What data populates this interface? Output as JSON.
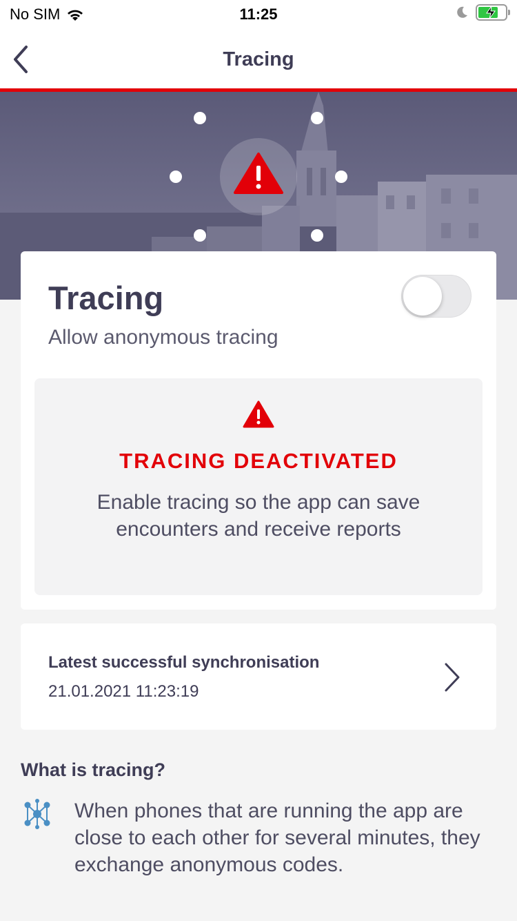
{
  "status_bar": {
    "carrier": "No SIM",
    "time": "11:25"
  },
  "nav": {
    "title": "Tracing",
    "accent_color": "#e20008"
  },
  "tracing_card": {
    "title": "Tracing",
    "subtitle": "Allow anonymous tracing",
    "toggle_on": false,
    "status": {
      "title": "TRACING DEACTIVATED",
      "text": "Enable tracing so the app can save encounters and receive reports",
      "color": "#e20008"
    }
  },
  "sync_card": {
    "title": "Latest successful synchronisation",
    "date": "21.01.2021 11:23:19"
  },
  "info": {
    "title": "What is tracing?",
    "text": "When phones that are running the app are close to each other for several minutes, they exchange anonymous codes."
  },
  "icons": [
    "wifi-icon",
    "moon-icon",
    "battery-icon",
    "back-icon",
    "warning-icon",
    "chevron-right-icon",
    "network-icon"
  ]
}
